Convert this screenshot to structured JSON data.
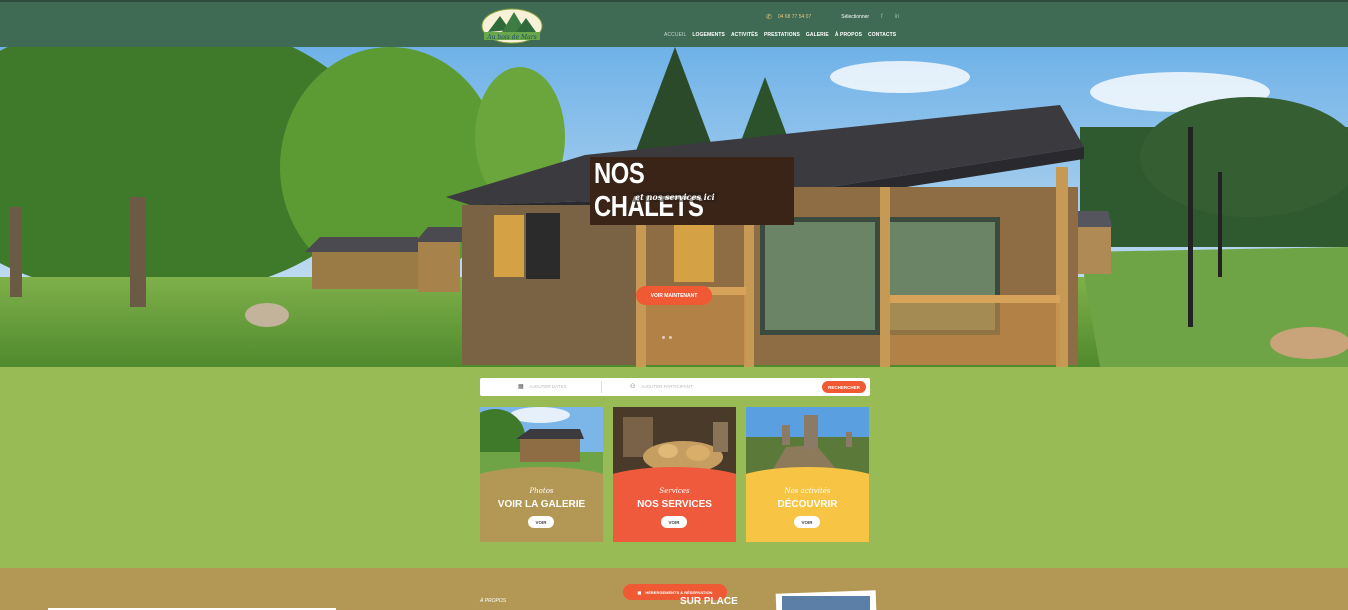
{
  "header": {
    "logo_text": "Au bois de Mars",
    "phone": "04 68 77 54 07",
    "lang": "Sélectionner",
    "social": [
      "f",
      "in"
    ],
    "nav": [
      {
        "label": "ACCUEIL",
        "active": true
      },
      {
        "label": "LOGEMENTS",
        "active": false
      },
      {
        "label": "ACTIVITÉS",
        "active": false
      },
      {
        "label": "PRESTATIONS",
        "active": false
      },
      {
        "label": "GALERIE",
        "active": false
      },
      {
        "label": "À PROPOS",
        "active": false
      },
      {
        "label": "CONTACTS",
        "active": false
      }
    ]
  },
  "hero": {
    "title": "NOS CHALETS",
    "subtitle": "et nos services ici",
    "button": "VOIR MAINTENANT"
  },
  "search": {
    "dates_placeholder": "AJOUTER DATES",
    "guests_placeholder": "AJOUTER PARTICIPANT",
    "button": "RECHERCHER"
  },
  "cards": [
    {
      "subtitle": "Photos",
      "title": "VOIR LA GALERIE",
      "button": "VOIR",
      "color": "#b39855"
    },
    {
      "subtitle": "Services",
      "title": "NOS SERVICES",
      "button": "VOIR",
      "color": "#f05a3c"
    },
    {
      "subtitle": "Nos activités",
      "title": "DÉCOUVRIR",
      "button": "VOIR",
      "color": "#f7c443"
    }
  ],
  "band": {
    "label": "À PROPOS",
    "heading": "SUR PLACE",
    "button": "HÉBERGEMENTS & RÉSERVATION"
  },
  "colors": {
    "header_bg": "#3f6b55",
    "page_bg": "#99bb55",
    "accent": "#ef5a35",
    "band_bg": "#b39855"
  }
}
